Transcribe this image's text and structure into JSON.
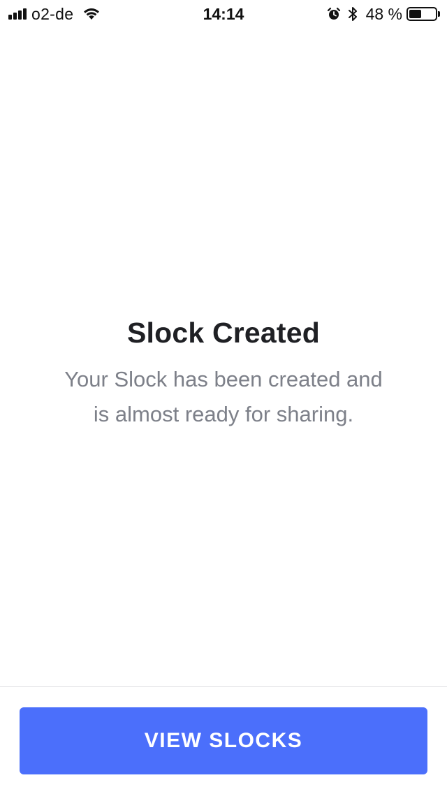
{
  "status_bar": {
    "carrier": "o2-de",
    "time": "14:14",
    "battery_percent_label": "48 %",
    "battery_level": 0.48,
    "icons": [
      "signal-icon",
      "wifi-icon",
      "alarm-icon",
      "bluetooth-icon",
      "battery-icon"
    ]
  },
  "screen": {
    "title": "Slock Created",
    "message": "Your Slock has been created and is almost ready for sharing."
  },
  "actions": {
    "primary_label": "VIEW SLOCKS"
  },
  "colors": {
    "primary_button": "#4b6ffb",
    "title_text": "#1f2024",
    "message_text": "#7d8089",
    "divider": "#e4e4e6"
  }
}
